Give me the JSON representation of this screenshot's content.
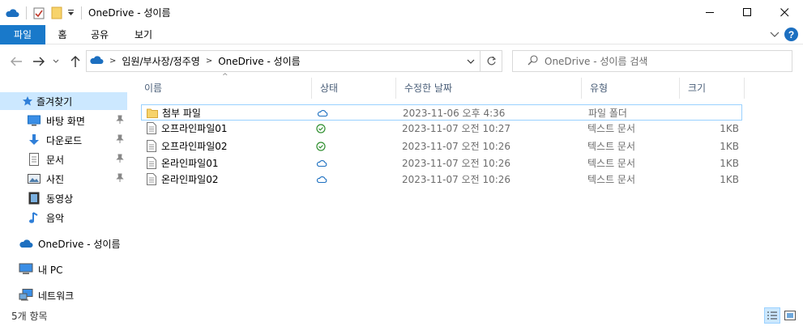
{
  "window": {
    "title": "OneDrive - 성이름"
  },
  "ribbon": {
    "tabs": [
      "파일",
      "홈",
      "공유",
      "보기"
    ],
    "help_label": "?"
  },
  "navigation": {
    "breadcrumb": [
      "임원/부사장/정주영",
      "OneDrive - 성이름"
    ],
    "search_placeholder": "OneDrive - 성이름 검색"
  },
  "sidebar": {
    "quick_access_label": "즐겨찾기",
    "quick_items": [
      "바탕 화면",
      "다운로드",
      "문서",
      "사진",
      "동영상",
      "음악"
    ],
    "onedrive_label": "OneDrive - 성이름",
    "thispc_label": "내 PC",
    "network_label": "네트워크"
  },
  "columns": [
    "이름",
    "상태",
    "수정한 날짜",
    "유형",
    "크기"
  ],
  "files": [
    {
      "name": "첨부 파일",
      "status": "cloud",
      "date": "2023-11-06 오후 4:36",
      "type": "파일 폴더",
      "size": ""
    },
    {
      "name": "오프라인파일01",
      "status": "synced",
      "date": "2023-11-07 오전 10:27",
      "type": "텍스트 문서",
      "size": "1KB"
    },
    {
      "name": "오프라인파일02",
      "status": "synced",
      "date": "2023-11-07 오전 10:26",
      "type": "텍스트 문서",
      "size": "1KB"
    },
    {
      "name": "온라인파일01",
      "status": "cloud",
      "date": "2023-11-07 오전 10:26",
      "type": "텍스트 문서",
      "size": "1KB"
    },
    {
      "name": "온라인파일02",
      "status": "cloud",
      "date": "2023-11-07 오전 10:26",
      "type": "텍스트 문서",
      "size": "1KB"
    }
  ],
  "status_bar": {
    "item_count": "5개 항목"
  },
  "colors": {
    "accent": "#1979ca",
    "cloud": "#1c6fc0",
    "synced": "#2f8f2f",
    "selection": "#cce8ff"
  }
}
